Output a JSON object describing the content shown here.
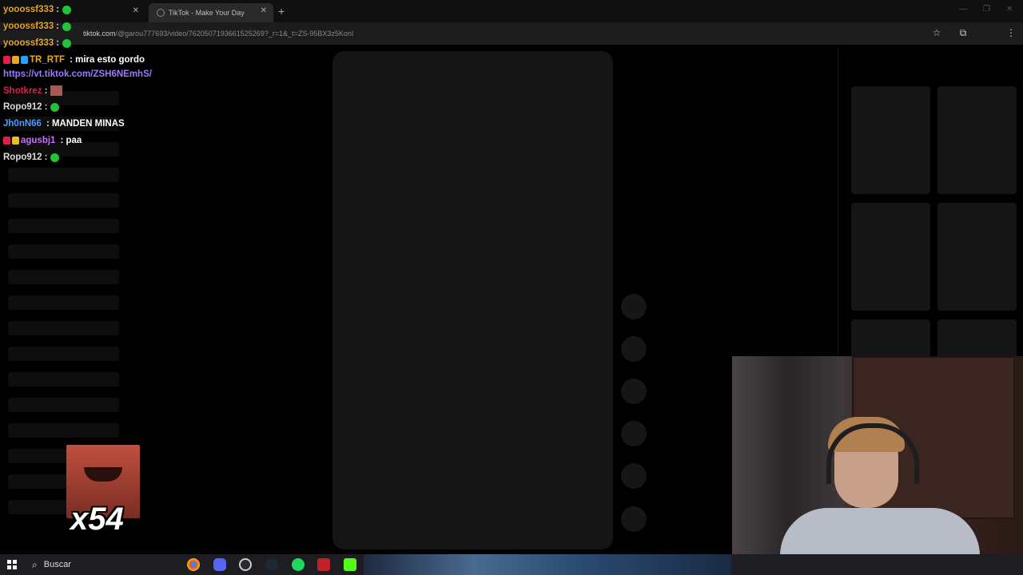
{
  "browser": {
    "tabs": [
      {
        "title": "yooossf333",
        "active": false
      },
      {
        "title": "TikTok - Make Your Day",
        "active": true
      }
    ],
    "url_domain": "tiktok.com",
    "url_path": "/@garou777693/video/7620507193661525269?_r=1&_t=ZS-95BX3z5KonI"
  },
  "chat": {
    "messages": [
      {
        "user": "yooossf333",
        "color": "#e8a820",
        "text": ":",
        "emote": "green"
      },
      {
        "user": "yooossf333",
        "color": "#e8a820",
        "text": ":",
        "emote": "green"
      },
      {
        "user": "yooossf333",
        "color": "#e8a820",
        "text": ":",
        "emote": "green"
      },
      {
        "user": "TR_RTF",
        "color": "#e8a820",
        "text": ": mira esto gordo",
        "emote": ""
      },
      {
        "user": "Shotkrez",
        "color": "#e0204a",
        "text": ":",
        "emote": "image"
      },
      {
        "user": "Ropo912",
        "color": "#dddddd",
        "text": ":",
        "emote": "green"
      },
      {
        "user": "Jh0nN66",
        "color": "#4aa0ff",
        "text": ": MANDEN MINAS",
        "emote": ""
      },
      {
        "user": "agusbj1",
        "color": "#d070ff",
        "text": ": paa",
        "emote": ""
      },
      {
        "user": "Ropo912",
        "color": "#dddddd",
        "text": ":",
        "emote": "green"
      }
    ],
    "link": "https://vt.tiktok.com/ZSH6NEmhS/",
    "combo": "x54"
  },
  "taskbar": {
    "search_placeholder": "Buscar",
    "apps": [
      "chrome-icon",
      "discord-icon",
      "obs-icon",
      "steam-icon",
      "spotify-icon",
      "voicemeeter-icon",
      "kick-icon"
    ]
  }
}
